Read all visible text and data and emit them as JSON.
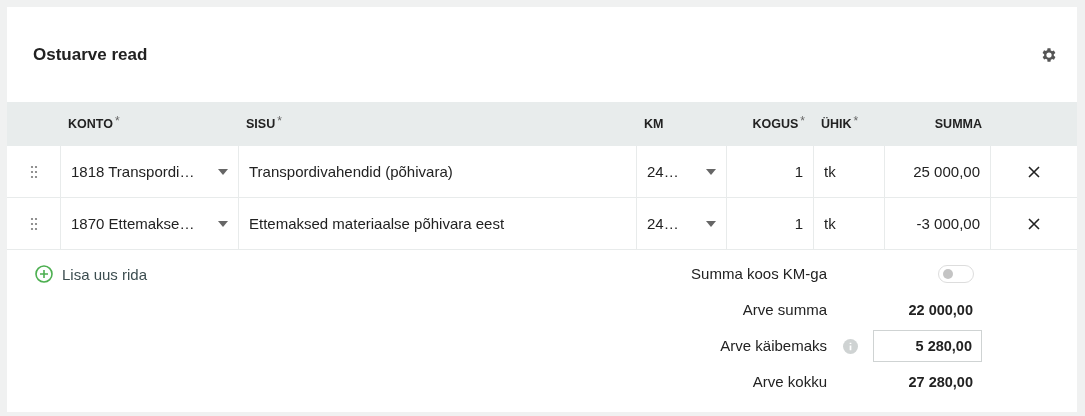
{
  "card": {
    "title": "Ostuarve read"
  },
  "table": {
    "columns": [
      {
        "label": "KONTO",
        "mark": "*"
      },
      {
        "label": "SISU",
        "mark": "*"
      },
      {
        "label": "KM"
      },
      {
        "label": "KOGUS",
        "mark": "*"
      },
      {
        "label": "ÜHIK",
        "mark": "*"
      },
      {
        "label": "SUMMA"
      }
    ],
    "rows": [
      {
        "konto": "1818 Transpordi…",
        "sisu": "Transpordivahendid (põhivara)",
        "km": "24…",
        "kogus": "1",
        "uhik": "tk",
        "summa": "25 000,00"
      },
      {
        "konto": "1870 Ettemakse…",
        "sisu": "Ettemaksed materiaalse põhivara eest",
        "km": "24…",
        "kogus": "1",
        "uhik": "tk",
        "summa": "-3 000,00"
      }
    ]
  },
  "add_row": {
    "label": "Lisa uus rida"
  },
  "totals": [
    {
      "kind": "toggle",
      "label": "Summa koos KM-ga",
      "on": false
    },
    {
      "kind": "value",
      "label": "Arve summa",
      "value": "22 000,00"
    },
    {
      "kind": "field",
      "label": "Arve käibemaks",
      "value": "5 280,00",
      "info": true
    },
    {
      "kind": "value",
      "label": "Arve kokku",
      "value": "27 280,00"
    }
  ]
}
